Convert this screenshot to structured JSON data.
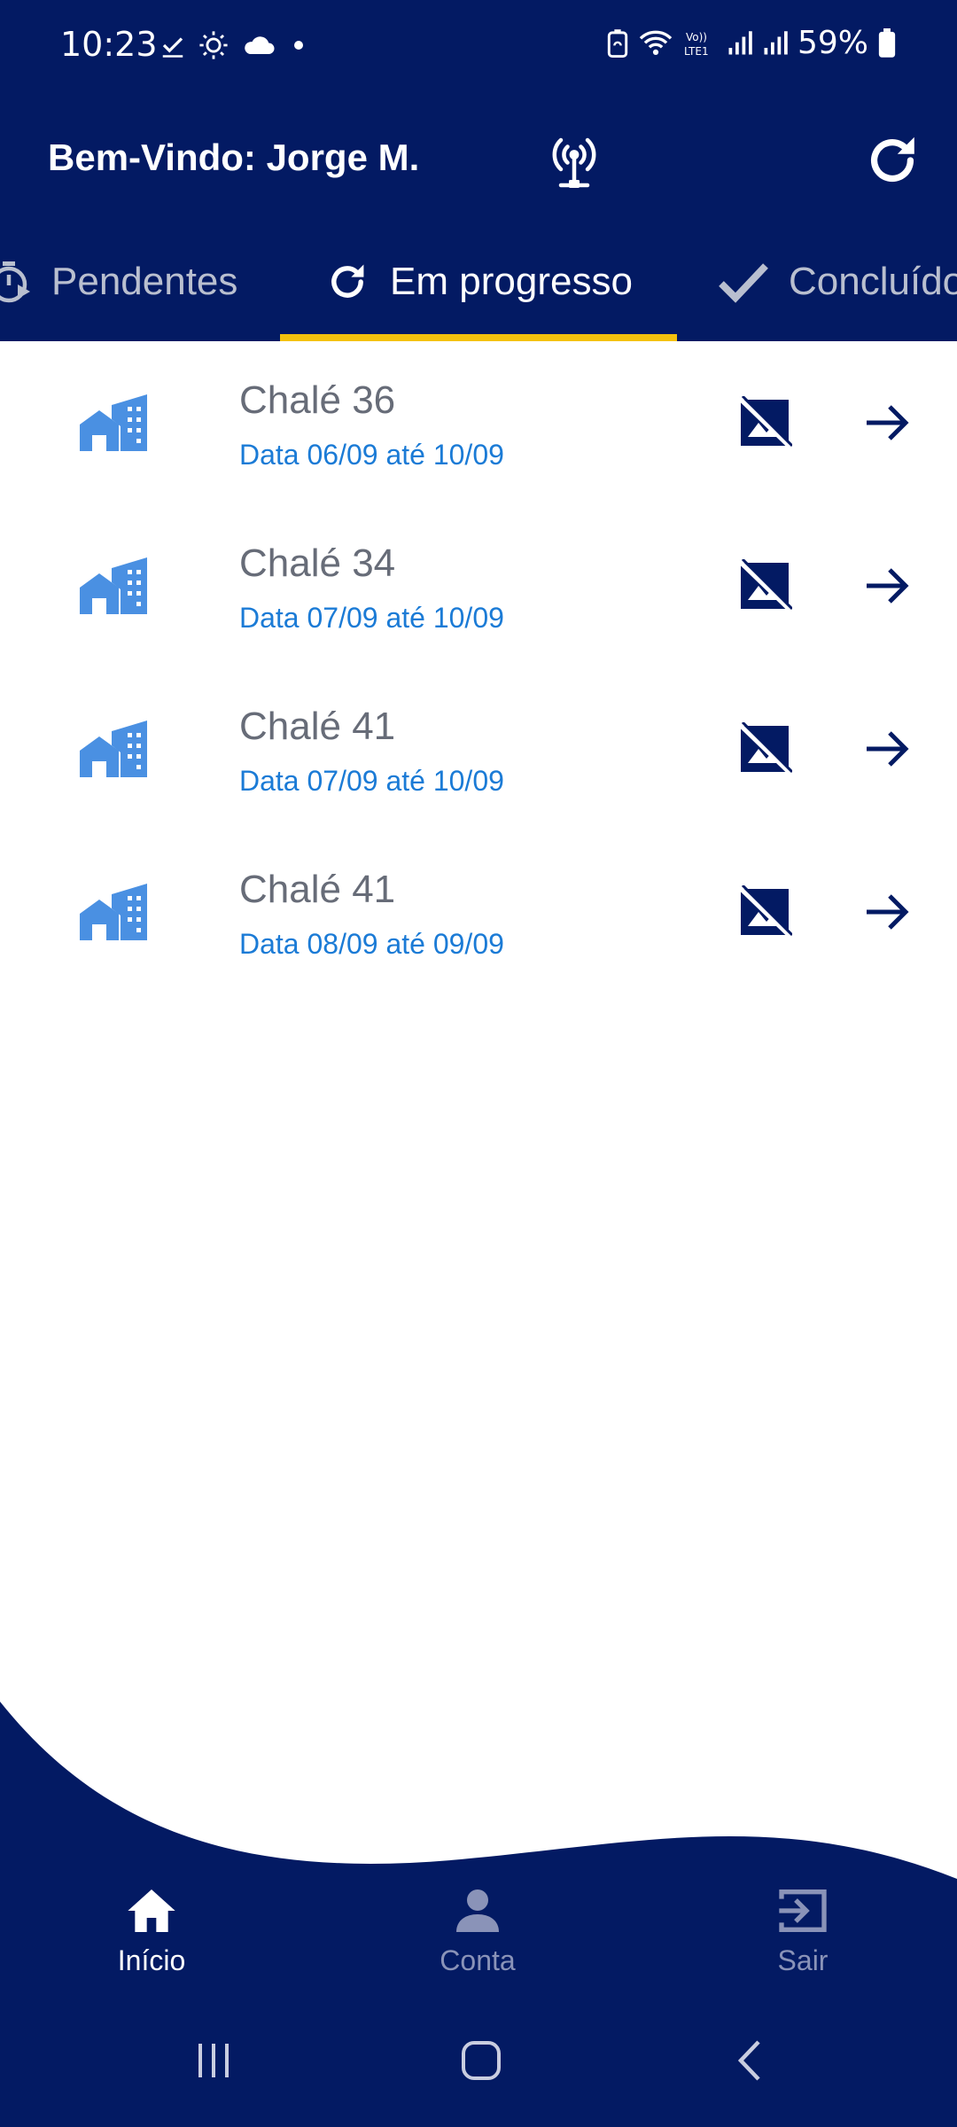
{
  "status_bar": {
    "time": "10:23",
    "battery": "59%",
    "icons": [
      "check-icon",
      "brightness-icon",
      "cloud-icon",
      "dot-icon",
      "battery-saver-icon",
      "wifi-icon",
      "volte-icon",
      "signal-icon",
      "signal-icon",
      "battery-icon"
    ]
  },
  "header": {
    "welcome": "Bem-Vindo: Jorge M.",
    "icons": [
      "antenna-icon",
      "refresh-icon"
    ]
  },
  "tabs": [
    {
      "label": "Pendentes",
      "icon": "timer-icon",
      "active": false
    },
    {
      "label": "Em progresso",
      "icon": "refresh-icon",
      "active": true
    },
    {
      "label": "Concluído",
      "icon": "check-icon",
      "active": false
    }
  ],
  "list": [
    {
      "title": "Chalé 36",
      "date": "Data 06/09 até 10/09"
    },
    {
      "title": "Chalé 34",
      "date": "Data 07/09 até 10/09"
    },
    {
      "title": "Chalé 41",
      "date": "Data 07/09 até 10/09"
    },
    {
      "title": "Chalé 41",
      "date": "Data 08/09 até 09/09"
    }
  ],
  "bottom_nav": [
    {
      "label": "Início",
      "icon": "home-icon",
      "active": true
    },
    {
      "label": "Conta",
      "icon": "person-icon",
      "active": false
    },
    {
      "label": "Sair",
      "icon": "exit-icon",
      "active": false
    }
  ],
  "colors": {
    "primary": "#031a63",
    "accent": "#f4c20d",
    "date_text": "#1b7bd6",
    "title_text": "#676c78",
    "building_icon": "#4a90e2"
  }
}
